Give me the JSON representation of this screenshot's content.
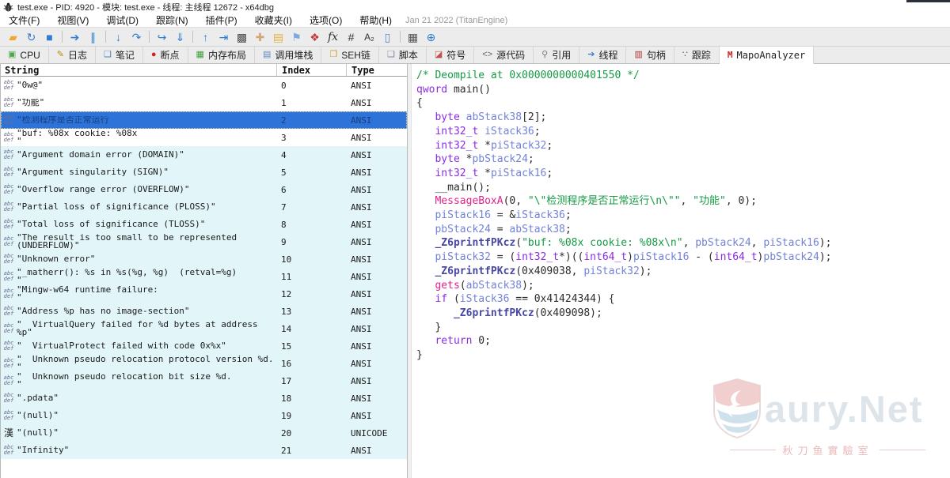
{
  "window": {
    "title": "test.exe - PID: 4920 - 模块: test.exe - 线程: 主线程 12672 - x64dbg"
  },
  "menu": {
    "items": [
      "文件(F)",
      "视图(V)",
      "调试(D)",
      "跟踪(N)",
      "插件(P)",
      "收藏夹(I)",
      "选项(O)",
      "帮助(H)"
    ],
    "build_info": "Jan 21 2022 (TitanEngine)"
  },
  "toolbar": {
    "accent": "#2d7dd2",
    "items": [
      {
        "name": "open-file-icon",
        "glyph": "▰",
        "color": "#f0a830"
      },
      {
        "name": "restart-icon",
        "glyph": "↻",
        "color": "#2d7dd2"
      },
      {
        "name": "close-icon",
        "glyph": "■",
        "color": "#2d7dd2"
      },
      {
        "name": "separator"
      },
      {
        "name": "run-icon",
        "glyph": "➔",
        "color": "#2d7dd2"
      },
      {
        "name": "pause-icon",
        "glyph": "∥",
        "color": "#2d7dd2"
      },
      {
        "name": "separator"
      },
      {
        "name": "step-into-icon",
        "glyph": "↓",
        "color": "#2d7dd2"
      },
      {
        "name": "step-over-icon",
        "glyph": "↷",
        "color": "#2d7dd2"
      },
      {
        "name": "separator"
      },
      {
        "name": "trace-into-icon",
        "glyph": "↪",
        "color": "#2d7dd2"
      },
      {
        "name": "trace-over-icon",
        "glyph": "⇓",
        "color": "#2d7dd2"
      },
      {
        "name": "separator"
      },
      {
        "name": "execute-till-return-icon",
        "glyph": "↑",
        "color": "#2d7dd2"
      },
      {
        "name": "run-to-user-code-icon",
        "glyph": "⇥",
        "color": "#2d7dd2"
      },
      {
        "name": "preferences-icon",
        "glyph": "▩",
        "color": "#4a4a4a"
      },
      {
        "name": "patches-icon",
        "glyph": "✚",
        "color": "#d2a679"
      },
      {
        "name": "comments-icon",
        "glyph": "▤",
        "color": "#e0b63e"
      },
      {
        "name": "labels-icon",
        "glyph": "⚑",
        "color": "#7fa8d9"
      },
      {
        "name": "bookmarks-icon",
        "glyph": "❖",
        "color": "#c23b3b"
      },
      {
        "name": "function-analysis-icon",
        "glyph": "fx",
        "color": "#333333",
        "style": "ital"
      },
      {
        "name": "hash-icon",
        "glyph": "#",
        "color": "#333333"
      },
      {
        "name": "font-size-icon",
        "glyph": "A₂",
        "color": "#333333",
        "style": "small"
      },
      {
        "name": "phone-icon",
        "glyph": "▯",
        "color": "#5b87c5"
      },
      {
        "name": "separator"
      },
      {
        "name": "calculator-icon",
        "glyph": "▦",
        "color": "#555555"
      },
      {
        "name": "globe-icon",
        "glyph": "⊕",
        "color": "#2d7dd2"
      }
    ]
  },
  "tabs": {
    "items": [
      {
        "label": "CPU",
        "icon": "cpu-icon",
        "glyph": "▣",
        "color": "#4ca64c",
        "active": false
      },
      {
        "label": "日志",
        "icon": "log-icon",
        "glyph": "✎",
        "color": "#b8860b",
        "active": false
      },
      {
        "label": "笔记",
        "icon": "notes-icon",
        "glyph": "❏",
        "color": "#4a7ebb",
        "active": false
      },
      {
        "label": "断点",
        "icon": "breakpoints-icon",
        "glyph": "●",
        "color": "#cc2222",
        "active": false
      },
      {
        "label": "内存布局",
        "icon": "memory-map-icon",
        "glyph": "▦",
        "color": "#3c9e3c",
        "active": false
      },
      {
        "label": "调用堆栈",
        "icon": "call-stack-icon",
        "glyph": "▤",
        "color": "#5b87c5",
        "active": false
      },
      {
        "label": "SEH链",
        "icon": "seh-chain-icon",
        "glyph": "❒",
        "color": "#c9a227",
        "active": false
      },
      {
        "label": "脚本",
        "icon": "script-icon",
        "glyph": "❑",
        "color": "#7a8aa0",
        "active": false
      },
      {
        "label": "符号",
        "icon": "symbols-icon",
        "glyph": "◪",
        "color": "#c0504d",
        "active": false
      },
      {
        "label": "源代码",
        "icon": "source-code-icon",
        "glyph": "<>",
        "color": "#666666",
        "active": false
      },
      {
        "label": "引用",
        "icon": "references-icon",
        "glyph": "⚲",
        "color": "#777777",
        "active": false
      },
      {
        "label": "线程",
        "icon": "threads-icon",
        "glyph": "➔",
        "color": "#3f7fd0",
        "active": false
      },
      {
        "label": "句柄",
        "icon": "handles-icon",
        "glyph": "▥",
        "color": "#b03030",
        "active": false
      },
      {
        "label": "跟踪",
        "icon": "trace-icon",
        "glyph": "∵",
        "color": "#555555",
        "active": false
      },
      {
        "label": "MapoAnalyzer",
        "icon": "mapoanalyzer-icon",
        "glyph": "M",
        "color": "#d02020",
        "active": true
      }
    ]
  },
  "strings_table": {
    "columns": [
      "String",
      "Index",
      "Type"
    ],
    "selection_color": "#2e74d8",
    "band_color": "#e2f5f9",
    "rows": [
      {
        "icon": "ansi",
        "text": "\"0w@\"",
        "index": "0",
        "type": "ANSI",
        "band": "white",
        "selected": false
      },
      {
        "icon": "ansi",
        "text": "\"功能\"",
        "index": "1",
        "type": "ANSI",
        "band": "white",
        "selected": false
      },
      {
        "icon": "ansi",
        "text": "\"检测程序是否正常运行",
        "index": "2",
        "type": "ANSI",
        "band": "white",
        "selected": true
      },
      {
        "icon": "ansi",
        "text": "\"buf: %08x cookie: %08x\n\"",
        "index": "3",
        "type": "ANSI",
        "band": "white",
        "selected": false
      },
      {
        "icon": "ansi",
        "text": "\"Argument domain error (DOMAIN)\"",
        "index": "4",
        "type": "ANSI",
        "band": "cyan",
        "selected": false
      },
      {
        "icon": "ansi",
        "text": "\"Argument singularity (SIGN)\"",
        "index": "5",
        "type": "ANSI",
        "band": "cyan",
        "selected": false
      },
      {
        "icon": "ansi",
        "text": "\"Overflow range error (OVERFLOW)\"",
        "index": "6",
        "type": "ANSI",
        "band": "cyan",
        "selected": false
      },
      {
        "icon": "ansi",
        "text": "\"Partial loss of significance (PLOSS)\"",
        "index": "7",
        "type": "ANSI",
        "band": "cyan",
        "selected": false
      },
      {
        "icon": "ansi",
        "text": "\"Total loss of significance (TLOSS)\"",
        "index": "8",
        "type": "ANSI",
        "band": "cyan",
        "selected": false
      },
      {
        "icon": "ansi",
        "text": "\"The result is too small to be represented (UNDERFLOW)\"",
        "index": "9",
        "type": "ANSI",
        "band": "cyan",
        "selected": false
      },
      {
        "icon": "ansi",
        "text": "\"Unknown error\"",
        "index": "10",
        "type": "ANSI",
        "band": "cyan",
        "selected": false
      },
      {
        "icon": "ansi",
        "text": "\"_matherr(): %s in %s(%g, %g)  (retval=%g)\n\"",
        "index": "11",
        "type": "ANSI",
        "band": "cyan",
        "selected": false
      },
      {
        "icon": "ansi",
        "text": "\"Mingw-w64 runtime failure:\n\"",
        "index": "12",
        "type": "ANSI",
        "band": "cyan",
        "selected": false
      },
      {
        "icon": "ansi",
        "text": "\"Address %p has no image-section\"",
        "index": "13",
        "type": "ANSI",
        "band": "cyan",
        "selected": false
      },
      {
        "icon": "ansi",
        "text": "\"  VirtualQuery failed for %d bytes at address %p\"",
        "index": "14",
        "type": "ANSI",
        "band": "cyan",
        "selected": false
      },
      {
        "icon": "ansi",
        "text": "\"  VirtualProtect failed with code 0x%x\"",
        "index": "15",
        "type": "ANSI",
        "band": "cyan",
        "selected": false
      },
      {
        "icon": "ansi",
        "text": "\"  Unknown pseudo relocation protocol version %d.\n\"",
        "index": "16",
        "type": "ANSI",
        "band": "cyan",
        "selected": false
      },
      {
        "icon": "ansi",
        "text": "\"  Unknown pseudo relocation bit size %d.\n\"",
        "index": "17",
        "type": "ANSI",
        "band": "cyan",
        "selected": false
      },
      {
        "icon": "ansi",
        "text": "\".pdata\"",
        "index": "18",
        "type": "ANSI",
        "band": "cyan",
        "selected": false
      },
      {
        "icon": "ansi",
        "text": "\"(null)\"",
        "index": "19",
        "type": "ANSI",
        "band": "cyan",
        "selected": false
      },
      {
        "icon": "unicode",
        "text": "\"(null)\"",
        "index": "20",
        "type": "UNICODE",
        "band": "cyan",
        "selected": false
      },
      {
        "icon": "ansi",
        "text": "\"Infinity\"",
        "index": "21",
        "type": "ANSI",
        "band": "cyan",
        "selected": false
      }
    ]
  },
  "code": {
    "comment_color": "#149a43",
    "lines": [
      [
        {
          "s": "com",
          "t": "/* Deompile at 0x0000000000401550 */"
        }
      ],
      [
        {
          "s": "kw",
          "t": "qword"
        },
        {
          "s": "pl",
          "t": " main()"
        }
      ],
      [
        {
          "s": "pl",
          "t": "{"
        }
      ],
      [
        {
          "s": "pl",
          "t": "   "
        },
        {
          "s": "kw",
          "t": "byte"
        },
        {
          "s": "pl",
          "t": " "
        },
        {
          "s": "var",
          "t": "abStack38"
        },
        {
          "s": "pl",
          "t": "[2];"
        }
      ],
      [
        {
          "s": "pl",
          "t": "   "
        },
        {
          "s": "kw",
          "t": "int32_t"
        },
        {
          "s": "pl",
          "t": " "
        },
        {
          "s": "var",
          "t": "iStack36"
        },
        {
          "s": "pl",
          "t": ";"
        }
      ],
      [
        {
          "s": "pl",
          "t": "   "
        },
        {
          "s": "kw",
          "t": "int32_t"
        },
        {
          "s": "pl",
          "t": " *"
        },
        {
          "s": "var",
          "t": "piStack32"
        },
        {
          "s": "pl",
          "t": ";"
        }
      ],
      [
        {
          "s": "pl",
          "t": "   "
        },
        {
          "s": "kw",
          "t": "byte"
        },
        {
          "s": "pl",
          "t": " *"
        },
        {
          "s": "var",
          "t": "pbStack24"
        },
        {
          "s": "pl",
          "t": ";"
        }
      ],
      [
        {
          "s": "pl",
          "t": "   "
        },
        {
          "s": "kw",
          "t": "int32_t"
        },
        {
          "s": "pl",
          "t": " *"
        },
        {
          "s": "var",
          "t": "piStack16"
        },
        {
          "s": "pl",
          "t": ";"
        }
      ],
      [
        {
          "s": "pl",
          "t": "   __main();"
        }
      ],
      [
        {
          "s": "pl",
          "t": "   "
        },
        {
          "s": "api",
          "t": "MessageBoxA"
        },
        {
          "s": "pl",
          "t": "(0, "
        },
        {
          "s": "str",
          "t": "\"\\\"检测程序是否正常运行\\n\\\"\""
        },
        {
          "s": "pl",
          "t": ", "
        },
        {
          "s": "str",
          "t": "\"功能\""
        },
        {
          "s": "pl",
          "t": ", 0);"
        }
      ],
      [
        {
          "s": "pl",
          "t": "   "
        },
        {
          "s": "var",
          "t": "piStack16"
        },
        {
          "s": "pl",
          "t": " = &"
        },
        {
          "s": "var",
          "t": "iStack36"
        },
        {
          "s": "pl",
          "t": ";"
        }
      ],
      [
        {
          "s": "pl",
          "t": "   "
        },
        {
          "s": "var",
          "t": "pbStack24"
        },
        {
          "s": "pl",
          "t": " = "
        },
        {
          "s": "var",
          "t": "abStack38"
        },
        {
          "s": "pl",
          "t": ";"
        }
      ],
      [
        {
          "s": "pl",
          "t": "   "
        },
        {
          "s": "fn",
          "t": "_Z6printfPKcz"
        },
        {
          "s": "pl",
          "t": "("
        },
        {
          "s": "str",
          "t": "\"buf: %08x cookie: %08x\\n\""
        },
        {
          "s": "pl",
          "t": ", "
        },
        {
          "s": "var",
          "t": "pbStack24"
        },
        {
          "s": "pl",
          "t": ", "
        },
        {
          "s": "var",
          "t": "piStack16"
        },
        {
          "s": "pl",
          "t": ");"
        }
      ],
      [
        {
          "s": "pl",
          "t": "   "
        },
        {
          "s": "var",
          "t": "piStack32"
        },
        {
          "s": "pl",
          "t": " = ("
        },
        {
          "s": "kw",
          "t": "int32_t"
        },
        {
          "s": "pl",
          "t": "*)(("
        },
        {
          "s": "kw",
          "t": "int64_t"
        },
        {
          "s": "pl",
          "t": ")"
        },
        {
          "s": "var",
          "t": "piStack16"
        },
        {
          "s": "pl",
          "t": " - ("
        },
        {
          "s": "kw",
          "t": "int64_t"
        },
        {
          "s": "pl",
          "t": ")"
        },
        {
          "s": "var",
          "t": "pbStack24"
        },
        {
          "s": "pl",
          "t": ");"
        }
      ],
      [
        {
          "s": "pl",
          "t": "   "
        },
        {
          "s": "fn",
          "t": "_Z6printfPKcz"
        },
        {
          "s": "pl",
          "t": "(0x409038, "
        },
        {
          "s": "var",
          "t": "piStack32"
        },
        {
          "s": "pl",
          "t": ");"
        }
      ],
      [
        {
          "s": "pl",
          "t": "   "
        },
        {
          "s": "api",
          "t": "gets"
        },
        {
          "s": "pl",
          "t": "("
        },
        {
          "s": "var",
          "t": "abStack38"
        },
        {
          "s": "pl",
          "t": ");"
        }
      ],
      [
        {
          "s": "pl",
          "t": "   "
        },
        {
          "s": "kw",
          "t": "if"
        },
        {
          "s": "pl",
          "t": " ("
        },
        {
          "s": "var",
          "t": "iStack36"
        },
        {
          "s": "pl",
          "t": " == 0x41424344) {"
        }
      ],
      [
        {
          "s": "pl",
          "t": "      "
        },
        {
          "s": "fn",
          "t": "_Z6printfPKcz"
        },
        {
          "s": "pl",
          "t": "(0x409098);"
        }
      ],
      [
        {
          "s": "pl",
          "t": "   }"
        }
      ],
      [
        {
          "s": "pl",
          "t": "   "
        },
        {
          "s": "kw",
          "t": "return"
        },
        {
          "s": "pl",
          "t": " 0;"
        }
      ],
      [
        {
          "s": "pl",
          "t": "}"
        }
      ]
    ]
  },
  "watermark": {
    "brand": "Saury.Net",
    "brand_display": "aury.Net",
    "subtitle": "秋刀鱼實驗室"
  }
}
